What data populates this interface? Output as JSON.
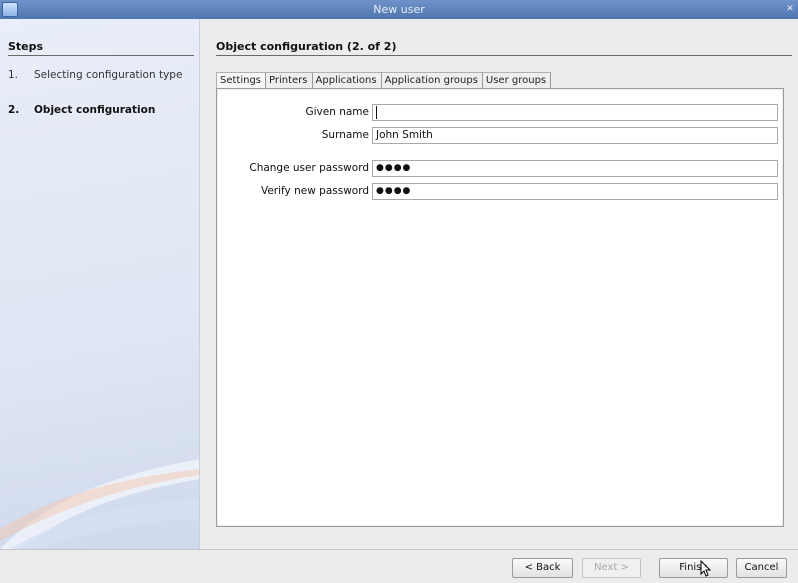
{
  "window": {
    "title": "New user"
  },
  "steps": {
    "title": "Steps",
    "items": [
      {
        "number": "1.",
        "label": "Selecting configuration type"
      },
      {
        "number": "2.",
        "label": "Object configuration"
      }
    ]
  },
  "page": {
    "title": "Object configuration (2. of 2)"
  },
  "tabs": [
    {
      "label": "Settings"
    },
    {
      "label": "Printers"
    },
    {
      "label": "Applications"
    },
    {
      "label": "Application groups"
    },
    {
      "label": "User groups"
    }
  ],
  "form": {
    "given_name": {
      "label": "Given name",
      "value": ""
    },
    "surname": {
      "label": "Surname",
      "value": "John Smith"
    },
    "change_password": {
      "label": "Change user password",
      "value": "●●●●"
    },
    "verify_password": {
      "label": "Verify new password",
      "value": "●●●●"
    }
  },
  "buttons": {
    "back": "< Back",
    "next": "Next >",
    "finish": "Finish",
    "cancel": "Cancel"
  }
}
